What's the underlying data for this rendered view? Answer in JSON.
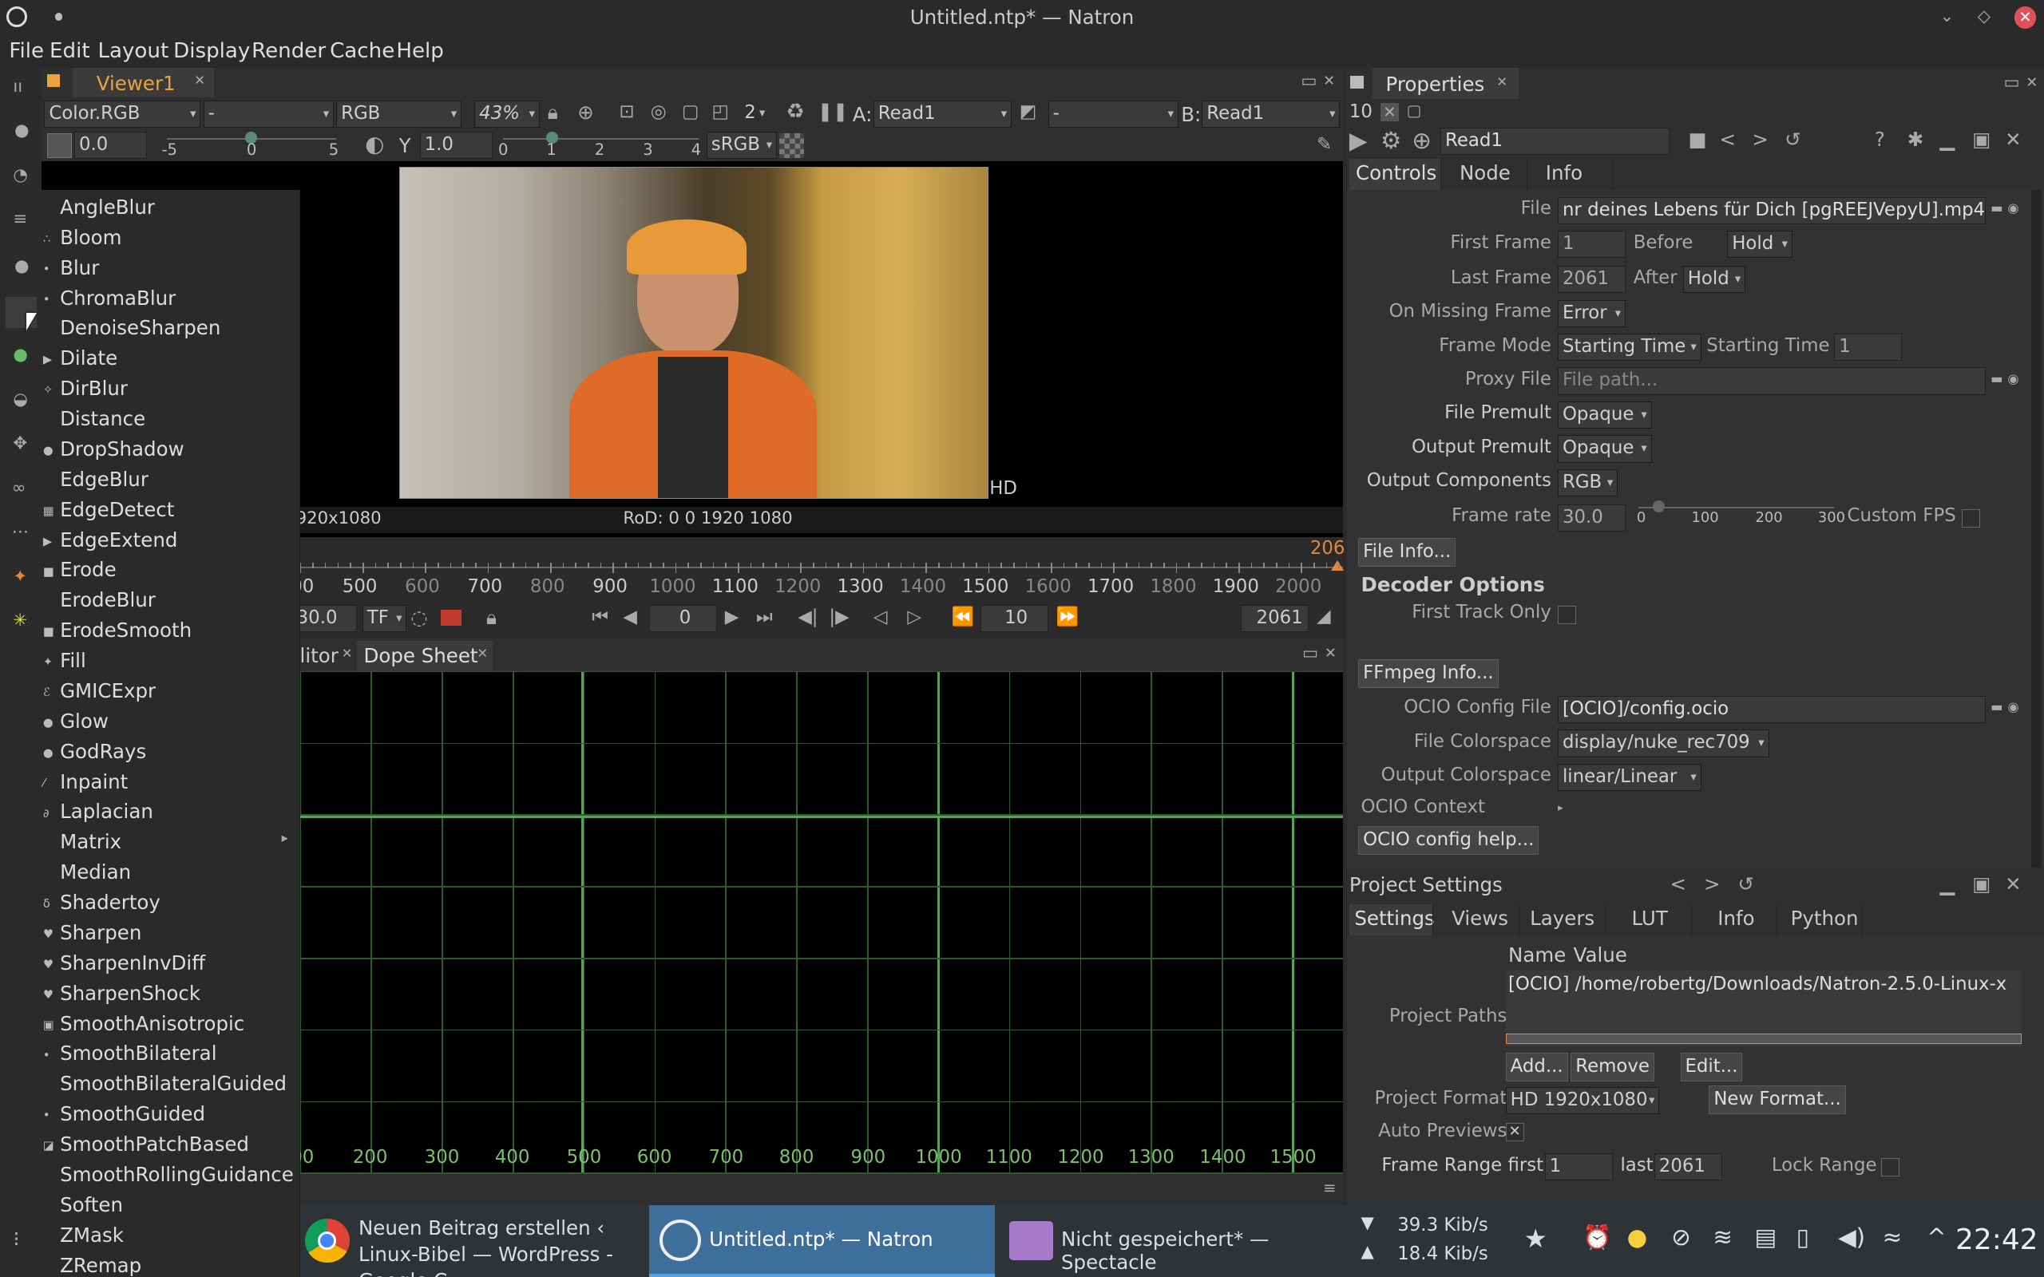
{
  "window": {
    "title": "Untitled.ntp* — Natron"
  },
  "menubar": [
    "File",
    "Edit",
    "Layout",
    "Display",
    "Render",
    "Cache",
    "Help"
  ],
  "viewer": {
    "tab": "Viewer1",
    "channels": "Color.RGB",
    "layer": "-",
    "display": "RGB",
    "zoom": "43%",
    "mip": "2",
    "input_a_label": "A:",
    "input_a": "Read1",
    "comp": "-",
    "input_b_label": "B:",
    "input_b": "Read1",
    "gain": "0.0",
    "gain_ticks": [
      "-5",
      "0",
      "5"
    ],
    "gamma_label": "Y",
    "gamma": "1.0",
    "gamma_ticks": [
      "0",
      "1",
      "2",
      "3",
      "4"
    ],
    "colorspace": "sRGB",
    "format_label": "HD",
    "resolution": "920x1080",
    "rod": "RoD: 0 0 1920 1080"
  },
  "timeline": {
    "ticks": [
      "00",
      "500",
      "600",
      "700",
      "800",
      "900",
      "1000",
      "1100",
      "1200",
      "1300",
      "1400",
      "1500",
      "1600",
      "1700",
      "1800",
      "1900",
      "2000"
    ],
    "end_marker": "206",
    "fps": "30.0",
    "tf": "TF",
    "current": "0",
    "step": "10",
    "last": "2061"
  },
  "bottom_panel": {
    "tabs": [
      "litor",
      "Dope Sheet"
    ],
    "ticks": [
      "00",
      "200",
      "300",
      "400",
      "500",
      "600",
      "700",
      "800",
      "900",
      "1000",
      "1100",
      "1200",
      "1300",
      "1400",
      "1500"
    ]
  },
  "context_menu": [
    "AngleBlur",
    "Bloom",
    "Blur",
    "ChromaBlur",
    "DenoiseSharpen",
    "Dilate",
    "DirBlur",
    "Distance",
    "DropShadow",
    "EdgeBlur",
    "EdgeDetect",
    "EdgeExtend",
    "Erode",
    "ErodeBlur",
    "ErodeSmooth",
    "Fill",
    "GMICExpr",
    "Glow",
    "GodRays",
    "Inpaint",
    "Laplacian",
    "Matrix",
    "Median",
    "Shadertoy",
    "Sharpen",
    "SharpenInvDiff",
    "SharpenShock",
    "SmoothAnisotropic",
    "SmoothBilateral",
    "SmoothBilateralGuided",
    "SmoothGuided",
    "SmoothPatchBased",
    "SmoothRollingGuidance",
    "Soften",
    "ZMask",
    "ZRemap"
  ],
  "properties": {
    "tab": "Properties",
    "max_panels": "10",
    "node_name": "Read1",
    "subtabs": [
      "Controls",
      "Node",
      "Info"
    ],
    "file_label": "File",
    "file": "nr deines Lebens für Dich [pgREEJVepyU].mp4",
    "first_frame_label": "First Frame",
    "first_frame": "1",
    "before_label": "Before",
    "before": "Hold",
    "last_frame_label": "Last Frame",
    "last_frame": "2061",
    "after_label": "After",
    "after": "Hold",
    "missing_label": "On Missing Frame",
    "missing": "Error",
    "frame_mode_label": "Frame Mode",
    "frame_mode": "Starting Time",
    "starting_time_label": "Starting Time",
    "starting_time": "1",
    "proxy_label": "Proxy File",
    "proxy_placeholder": "File path...",
    "file_premult_label": "File Premult",
    "file_premult": "Opaque",
    "output_premult_label": "Output Premult",
    "output_premult": "Opaque",
    "output_comp_label": "Output Components",
    "output_comp": "RGB",
    "frame_rate_label": "Frame rate",
    "frame_rate": "30.0",
    "fr_ticks": [
      "0",
      "100",
      "200",
      "300"
    ],
    "custom_fps_label": "Custom FPS",
    "file_info_btn": "File Info...",
    "decoder_heading": "Decoder Options",
    "first_track_label": "First Track Only",
    "ffmpeg_btn": "FFmpeg Info...",
    "ocio_file_label": "OCIO Config File",
    "ocio_file": "[OCIO]/config.ocio",
    "file_cs_label": "File Colorspace",
    "file_cs": "display/nuke_rec709",
    "out_cs_label": "Output Colorspace",
    "out_cs": "linear/Linear",
    "ocio_ctx_label": "OCIO Context",
    "ocio_help_btn": "OCIO config help..."
  },
  "project": {
    "title": "Project Settings",
    "tabs": [
      "Settings",
      "Views",
      "Layers",
      "LUT",
      "Info",
      "Python"
    ],
    "col_name": "Name",
    "col_value": "Value",
    "paths_label": "Project Paths",
    "path_value": "[OCIO] /home/robertg/Downloads/Natron-2.5.0-Linux-x",
    "add_btn": "Add...",
    "remove_btn": "Remove",
    "edit_btn": "Edit...",
    "format_label": "Project Format",
    "format": "HD 1920x1080",
    "new_format_btn": "New Format...",
    "auto_previews_label": "Auto Previews",
    "range_label": "Frame Range first",
    "range_first": "1",
    "range_last_label": "last",
    "range_last": "2061",
    "lock_label": "Lock Range"
  },
  "taskbar": {
    "items": [
      {
        "title": "Neuen Beitrag erstellen ‹ Linux-Bibel — WordPress - Google C...",
        "icon": "chrome-icon"
      },
      {
        "title": "Untitled.ntp* — Natron",
        "icon": "natron-icon"
      },
      {
        "title": "Nicht gespeichert* — Spectacle",
        "icon": "spectacle-icon"
      }
    ],
    "down": "39.3 Kib/s",
    "up": "18.4 Kib/s",
    "clock": "22:42"
  }
}
